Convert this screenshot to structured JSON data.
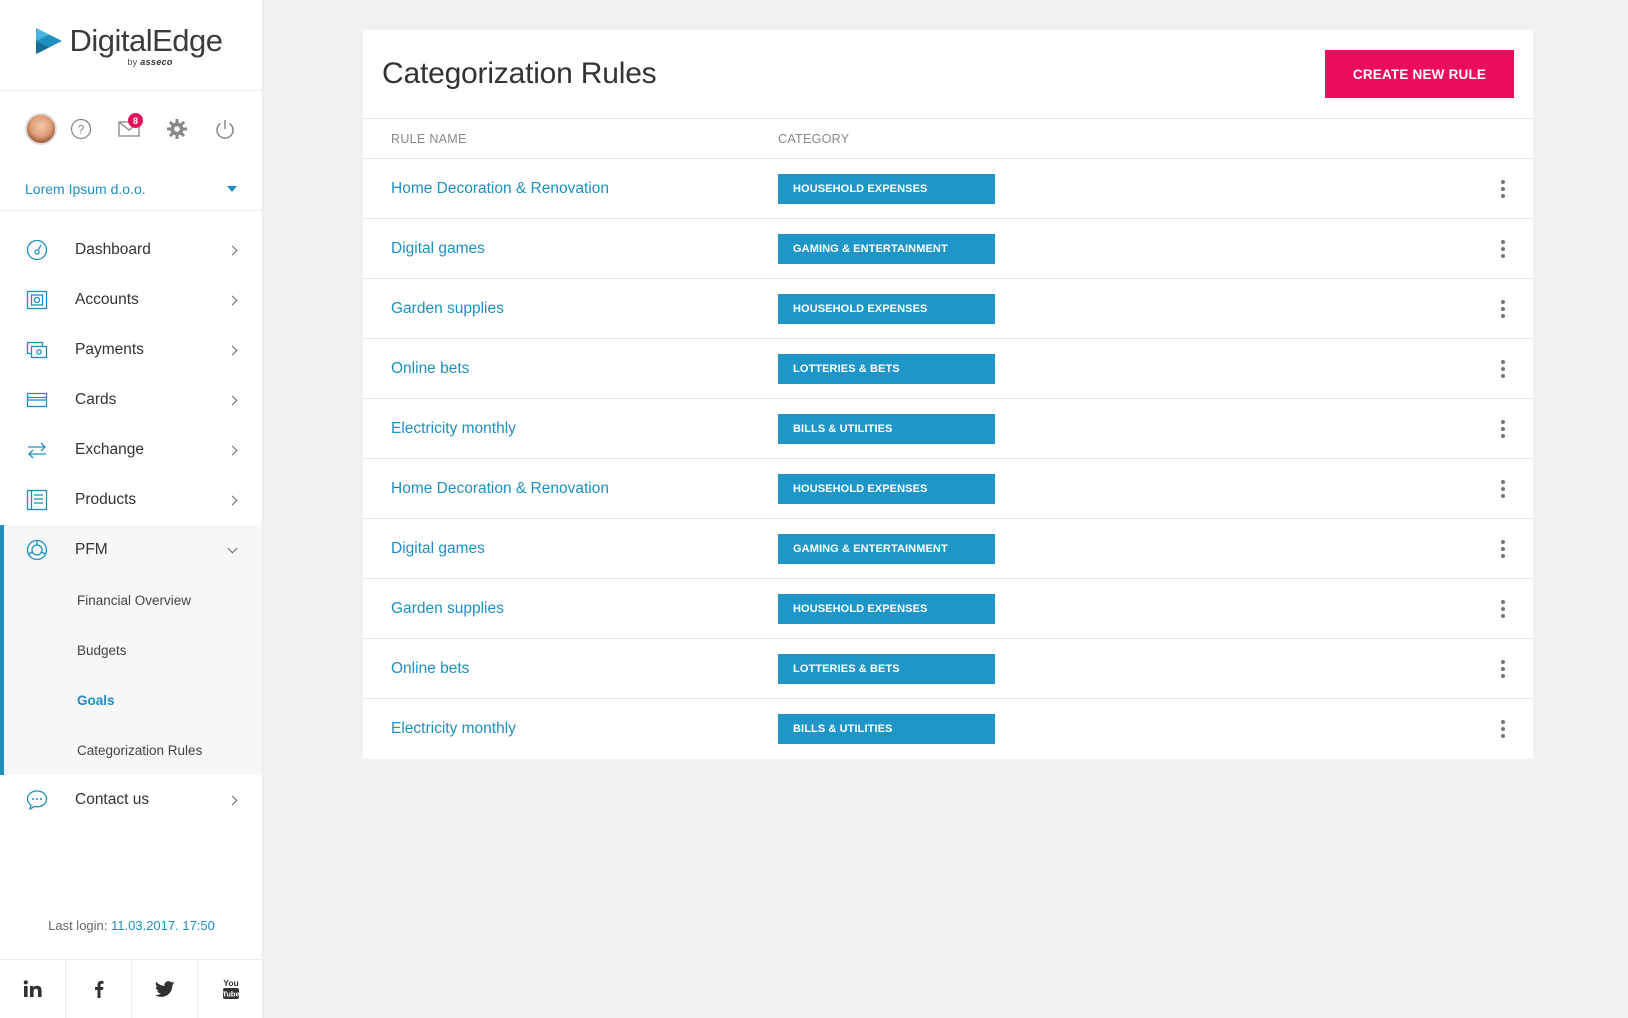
{
  "brand": {
    "name_light": "Digital",
    "name_dark": "Edge",
    "by": "by",
    "by_brand": "asseco"
  },
  "user": {
    "company": "Lorem Ipsum d.o.o.",
    "unread_messages": "8"
  },
  "sidebar": {
    "items": [
      {
        "label": "Dashboard",
        "icon": "dashboard-icon"
      },
      {
        "label": "Accounts",
        "icon": "accounts-icon"
      },
      {
        "label": "Payments",
        "icon": "payments-icon"
      },
      {
        "label": "Cards",
        "icon": "card-icon"
      },
      {
        "label": "Exchange",
        "icon": "exchange-icon"
      },
      {
        "label": "Products",
        "icon": "products-icon"
      }
    ],
    "pfm": {
      "label": "PFM",
      "sub": [
        "Financial Overview",
        "Budgets",
        "Goals",
        "Categorization Rules"
      ],
      "active": "Goals"
    },
    "contact": {
      "label": "Contact us"
    },
    "last_login_label": "Last login:",
    "last_login_value": "11.03.2017. 17:50"
  },
  "social": [
    "linkedin-icon",
    "facebook-icon",
    "twitter-icon",
    "youtube-icon"
  ],
  "main": {
    "title": "Categorization Rules",
    "create_button": "CREATE NEW RULE",
    "columns": {
      "rule_name": "RULE NAME",
      "category": "CATEGORY"
    },
    "rows": [
      {
        "name": "Home Decoration & Renovation",
        "category": "HOUSEHOLD EXPENSES"
      },
      {
        "name": "Digital games",
        "category": "GAMING & ENTERTAINMENT"
      },
      {
        "name": "Garden supplies",
        "category": "HOUSEHOLD EXPENSES"
      },
      {
        "name": "Online bets",
        "category": "LOTTERIES & BETS"
      },
      {
        "name": "Electricity monthly",
        "category": "BILLS & UTILITIES"
      },
      {
        "name": "Home Decoration & Renovation",
        "category": "HOUSEHOLD EXPENSES"
      },
      {
        "name": "Digital games",
        "category": "GAMING & ENTERTAINMENT"
      },
      {
        "name": "Garden supplies",
        "category": "HOUSEHOLD EXPENSES"
      },
      {
        "name": "Online bets",
        "category": "LOTTERIES & BETS"
      },
      {
        "name": "Electricity monthly",
        "category": "BILLS & UTILITIES"
      }
    ]
  },
  "colors": {
    "accent": "#1f8fc0",
    "badge": "#1f96c8",
    "primary_button": "#ec0c5b",
    "notification": "#e3125a"
  }
}
